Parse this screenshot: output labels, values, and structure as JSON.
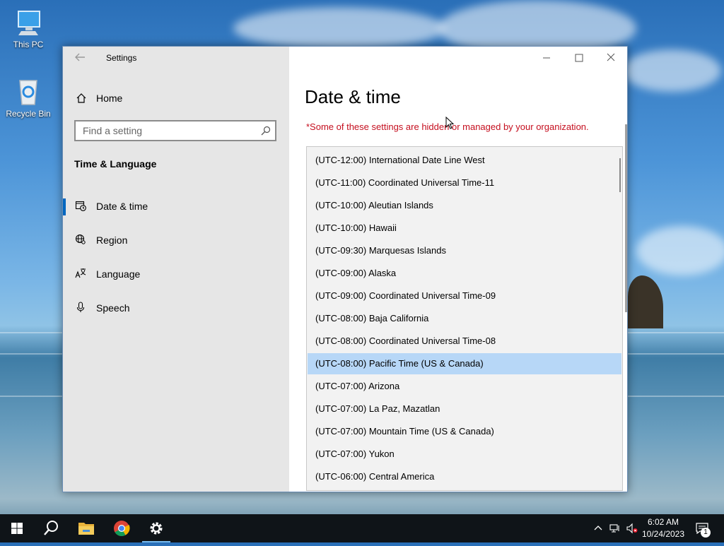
{
  "desktop": {
    "icons": [
      {
        "label": "This PC"
      },
      {
        "label": "Recycle Bin"
      }
    ]
  },
  "window": {
    "title": "Settings",
    "home_label": "Home",
    "search": {
      "placeholder": "Find a setting",
      "value": ""
    },
    "section_title": "Time & Language",
    "nav_items": [
      {
        "label": "Date & time",
        "icon": "calendar-clock-icon",
        "selected": true
      },
      {
        "label": "Region",
        "icon": "globe-icon",
        "selected": false
      },
      {
        "label": "Language",
        "icon": "language-icon",
        "selected": false
      },
      {
        "label": "Speech",
        "icon": "microphone-icon",
        "selected": false
      }
    ],
    "page_title": "Date & time",
    "managed_note": "*Some of these settings are hidden or managed by your organization.",
    "timezones": [
      "(UTC-12:00) International Date Line West",
      "(UTC-11:00) Coordinated Universal Time-11",
      "(UTC-10:00) Aleutian Islands",
      "(UTC-10:00) Hawaii",
      "(UTC-09:30) Marquesas Islands",
      "(UTC-09:00) Alaska",
      "(UTC-09:00) Coordinated Universal Time-09",
      "(UTC-08:00) Baja California",
      "(UTC-08:00) Coordinated Universal Time-08",
      "(UTC-08:00) Pacific Time (US & Canada)",
      "(UTC-07:00) Arizona",
      "(UTC-07:00) La Paz, Mazatlan",
      "(UTC-07:00) Mountain Time (US & Canada)",
      "(UTC-07:00) Yukon",
      "(UTC-06:00) Central America"
    ],
    "selected_timezone": "(UTC-08:00) Pacific Time (US & Canada)",
    "colors": {
      "accent": "#0067c0",
      "selection": "#b7d7f7",
      "warning": "#c50f1f"
    }
  },
  "taskbar": {
    "apps": [
      "start-icon",
      "search-icon",
      "file-explorer-icon",
      "chrome-icon",
      "settings-icon"
    ],
    "clock": {
      "time": "6:02 AM",
      "date": "10/24/2023"
    },
    "notification_count": "1"
  }
}
